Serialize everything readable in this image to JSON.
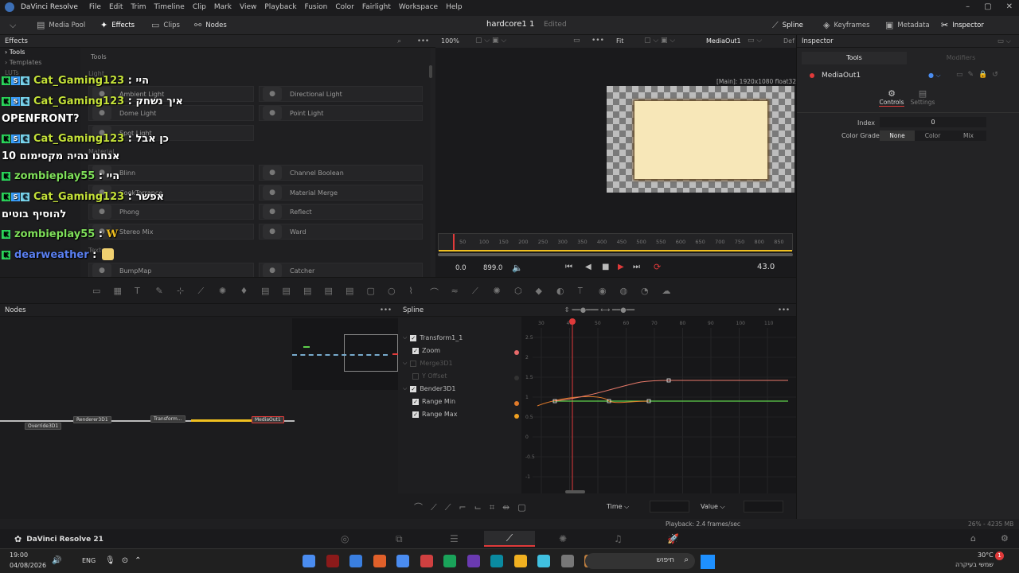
{
  "app": {
    "name": "DaVinci Resolve",
    "menu": [
      "File",
      "Edit",
      "Trim",
      "Timeline",
      "Clip",
      "Mark",
      "View",
      "Playback",
      "Fusion",
      "Color",
      "Fairlight",
      "Workspace",
      "Help"
    ]
  },
  "topbar": {
    "left": [
      "Media Pool",
      "Effects",
      "Clips",
      "Nodes"
    ],
    "project": "hardcore1 1",
    "edited": "Edited",
    "right": [
      "Spline",
      "Keyframes",
      "Metadata",
      "Inspector"
    ]
  },
  "effects": {
    "title": "Effects",
    "tree": [
      "Tools",
      "Templates",
      "LUTs"
    ],
    "grid_header": "Tools",
    "categories": [
      "Light",
      "Material",
      "Texture"
    ],
    "tiles": [
      "Ambient Light",
      "Directional Light",
      "Dome Light",
      "Point Light",
      "Spot Light",
      "Blinn",
      "Channel Boolean",
      "CookTorrance",
      "Material Merge",
      "Phong",
      "Reflect",
      "Stereo Mix",
      "Ward",
      "BumpMap",
      "Catcher"
    ]
  },
  "chat": [
    {
      "badges": [
        "K",
        "S",
        "C"
      ],
      "user": "Cat_Gaming123",
      "sep": " : ",
      "msg": "היי"
    },
    {
      "badges": [
        "K",
        "S",
        "C"
      ],
      "user": "Cat_Gaming123",
      "sep": " : ",
      "msg": "איך נשחק"
    },
    {
      "badges": [],
      "user": "",
      "sep": "",
      "msg": "OPENFRONT?"
    },
    {
      "badges": [
        "K",
        "S",
        "C"
      ],
      "user": "Cat_Gaming123",
      "sep": " : ",
      "msg": "כן אבל"
    },
    {
      "badges": [],
      "user": "",
      "sep": "",
      "msg": "אנחנו נהיה מקסימום 10"
    },
    {
      "badges": [
        "K"
      ],
      "user": "zombieplay55",
      "sep": " : ",
      "msg": "היי"
    },
    {
      "badges": [
        "K",
        "S",
        "C"
      ],
      "user": "Cat_Gaming123",
      "sep": " : ",
      "msg": "אפשר"
    },
    {
      "badges": [],
      "user": "",
      "sep": "",
      "msg": "להוסיף בוטים"
    },
    {
      "badges": [
        "K"
      ],
      "user": "zombieplay55",
      "sep": " : ",
      "msg": "W"
    },
    {
      "badges": [
        "K"
      ],
      "user": "dearweather",
      "sep": " : ",
      "msg": ""
    }
  ],
  "viewer": {
    "zoom": "100%",
    "fit": "Fit",
    "output": "MediaOut1",
    "extra": "Def",
    "resolution": "[Main]: 1920x1080 float32",
    "ticks": [
      "50",
      "100",
      "150",
      "200",
      "250",
      "300",
      "350",
      "400",
      "450",
      "500",
      "550",
      "600",
      "650",
      "700",
      "750",
      "800",
      "850"
    ],
    "time_start": "0.0",
    "time_end": "899.0",
    "current_time": "43.0"
  },
  "nodes": {
    "title": "Nodes",
    "items": [
      "Override3D1",
      "Renderer3D1",
      "Transform...",
      "MediaOut1"
    ]
  },
  "spline": {
    "title": "Spline",
    "list": [
      {
        "label": "Transform1_1",
        "checked": true,
        "indent": 0
      },
      {
        "label": "Zoom",
        "checked": true,
        "indent": 1
      },
      {
        "label": "Merge3D1",
        "checked": false,
        "indent": 0
      },
      {
        "label": "Y Offset",
        "checked": false,
        "indent": 1
      },
      {
        "label": "Bender3D1",
        "checked": true,
        "indent": 0
      },
      {
        "label": "Range Min",
        "checked": true,
        "indent": 1
      },
      {
        "label": "Range Max",
        "checked": true,
        "indent": 1
      }
    ],
    "xticks": [
      "30",
      "40",
      "50",
      "60",
      "70",
      "80",
      "90",
      "100",
      "110"
    ],
    "yticks": [
      "2.5",
      "2",
      "1.5",
      "1",
      "0.5",
      "0",
      "-0.5",
      "-1"
    ],
    "time_label": "Time",
    "value_label": "Value"
  },
  "inspector": {
    "title": "Inspector",
    "tabs": [
      "Tools",
      "Modifiers"
    ],
    "node": "MediaOut1",
    "subtabs": [
      "Controls",
      "Settings"
    ],
    "index_label": "Index",
    "index_value": "0",
    "grade_label": "Color Grade",
    "grade_options": [
      "None",
      "Color",
      "Mix"
    ]
  },
  "status": {
    "playback": "Playback: 2.4 frames/sec",
    "memory": "26% - 4235 MB"
  },
  "pagebar": {
    "app": "DaVinci Resolve 21"
  },
  "taskbar": {
    "time": "19:00",
    "date": "04/08/2026",
    "lang": "ENG",
    "search": "חיפוש",
    "weather_temp": "30°C",
    "weather_desc": "שמשי בעיקרה",
    "notif": "1"
  },
  "colors": {
    "accent_red": "#e03a3a",
    "orange": "#e07a2a",
    "green": "#5ecf4c",
    "yellow": "#f0c020"
  }
}
